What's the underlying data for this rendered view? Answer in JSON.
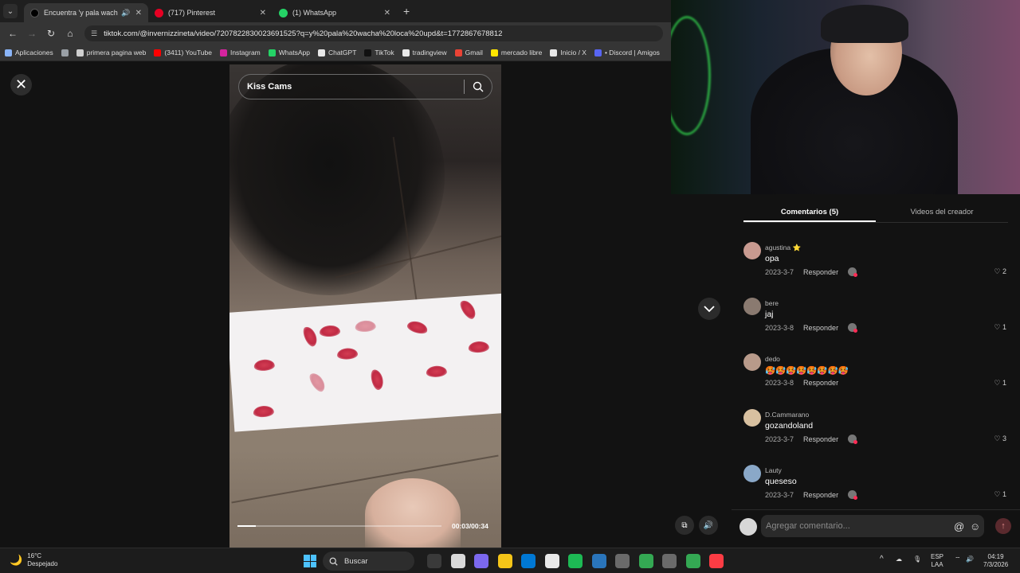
{
  "browser": {
    "tabs": [
      {
        "title": "Encuentra 'y pala wacha lo",
        "active": true,
        "favicon_color": "#000000"
      },
      {
        "title": "(717) Pinterest",
        "active": false,
        "favicon_color": "#e60023"
      },
      {
        "title": "(1) WhatsApp",
        "active": false,
        "favicon_color": "#25d366"
      }
    ],
    "url": "tiktok.com/@invernizzineta/video/7207822830023691525?q=y%20pala%20wacha%20loca%20upd&t=1772867678812",
    "bookmarks": [
      {
        "label": "Aplicaciones",
        "color": "#8ab4f8"
      },
      {
        "label": "",
        "color": "#9aa0a6"
      },
      {
        "label": "primera pagina web",
        "color": "#cfcfcf"
      },
      {
        "label": "(3411) YouTube",
        "color": "#ff0000"
      },
      {
        "label": "Instagram",
        "color": "#d6249f"
      },
      {
        "label": "WhatsApp",
        "color": "#25d366"
      },
      {
        "label": "ChatGPT",
        "color": "#e8e8e8"
      },
      {
        "label": "TikTok",
        "color": "#111111"
      },
      {
        "label": "tradingview",
        "color": "#e8e8e8"
      },
      {
        "label": "Gmail",
        "color": "#ea4335"
      },
      {
        "label": "mercado libre",
        "color": "#ffe600"
      },
      {
        "label": "Inicio / X",
        "color": "#e8e8e8"
      },
      {
        "label": "• Discord | Amigos",
        "color": "#5865f2"
      }
    ]
  },
  "search": {
    "query": "Kiss Cams"
  },
  "player": {
    "time": "00:03/00:34",
    "progress": 0.088
  },
  "panel": {
    "tabs": [
      {
        "label": "Comentarios (5)",
        "active": true
      },
      {
        "label": "Videos del creador",
        "active": false
      }
    ],
    "reply_label": "Responder",
    "comments": [
      {
        "user": "agustina ⭐",
        "text": "opa",
        "date": "2023-3-7",
        "likes": "2",
        "avatar_color": "#c89a90",
        "has_creator": true
      },
      {
        "user": "bere",
        "text": "jaj",
        "date": "2023-3-8",
        "likes": "1",
        "avatar_color": "#8a7a70",
        "has_creator": true
      },
      {
        "user": "dedo",
        "text": "🥵🥵🥵🥵🥵🥵🥵🥵",
        "date": "2023-3-8",
        "likes": "1",
        "avatar_color": "#b89a8a",
        "has_creator": false
      },
      {
        "user": "D.Cammarano",
        "text": "gozandoland",
        "date": "2023-3-7",
        "likes": "3",
        "avatar_color": "#d8c0a0",
        "has_creator": true
      },
      {
        "user": "Lauty",
        "text": "queseso",
        "date": "2023-3-7",
        "likes": "1",
        "avatar_color": "#8aa8c8",
        "has_creator": true
      }
    ],
    "add_comment_placeholder": "Agregar comentario..."
  },
  "taskbar": {
    "weather_temp": "16°C",
    "weather_desc": "Despejado",
    "search_label": "Buscar",
    "lang_top": "ESP",
    "lang_bottom": "LAA",
    "time": "04:19",
    "date": "7/3/2026",
    "apps": [
      "#3a3a3a",
      "#d9d9d9",
      "#7b68ee",
      "#f5c518",
      "#0078d4",
      "#e8e8e8",
      "#1db954",
      "#2a75bb",
      "#6a6a6a",
      "#34a853",
      "#6a6a6a",
      "#34a853",
      "#fc3c44"
    ]
  },
  "colors": {
    "accent": "#fe2c55",
    "background": "#121212"
  }
}
